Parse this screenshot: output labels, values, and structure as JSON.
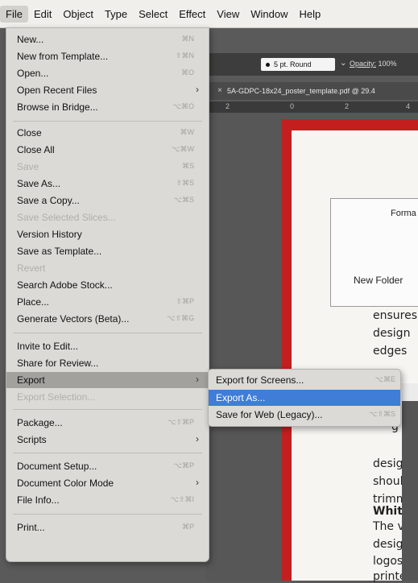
{
  "menubar": [
    "File",
    "Edit",
    "Object",
    "Type",
    "Select",
    "Effect",
    "View",
    "Window",
    "Help"
  ],
  "control_bar": {
    "stroke": "5 pt. Round",
    "opacity_label": "Opacity:",
    "opacity_value": "100%"
  },
  "document_tab": "5A-GDPC-18x24_poster_template.pdf @ 29.4",
  "ruler_ticks": [
    "2",
    "0",
    "2",
    "4"
  ],
  "dialog": {
    "format_label": "Forma",
    "new_folder": "New Folder"
  },
  "poster_text": [
    "ensures",
    "design",
    "edges",
    "g",
    "desig",
    "shoul",
    "trimm",
    "Whit",
    "The v",
    "desig",
    "logos",
    "printe"
  ],
  "file_menu": {
    "new": "New...",
    "new_k": "⌘N",
    "new_template": "New from Template...",
    "new_template_k": "⇧⌘N",
    "open": "Open...",
    "open_k": "⌘O",
    "open_recent": "Open Recent Files",
    "open_recent_arrow": "›",
    "bridge": "Browse in Bridge...",
    "bridge_k": "⌥⌘O",
    "close": "Close",
    "close_k": "⌘W",
    "close_all": "Close All",
    "close_all_k": "⌥⌘W",
    "save": "Save",
    "save_k": "⌘S",
    "save_as": "Save As...",
    "save_as_k": "⇧⌘S",
    "save_copy": "Save a Copy...",
    "save_copy_k": "⌥⌘S",
    "save_selected": "Save Selected Slices...",
    "version_history": "Version History",
    "save_template": "Save as Template...",
    "revert": "Revert",
    "search_stock": "Search Adobe Stock...",
    "place": "Place...",
    "place_k": "⇧⌘P",
    "gen_vectors": "Generate Vectors (Beta)...",
    "gen_vectors_k": "⌥⇧⌘G",
    "invite": "Invite to Edit...",
    "share_review": "Share for Review...",
    "export": "Export",
    "export_arrow": "›",
    "export_selection": "Export Selection...",
    "package": "Package...",
    "package_k": "⌥⇧⌘P",
    "scripts": "Scripts",
    "scripts_arrow": "›",
    "doc_setup": "Document Setup...",
    "doc_setup_k": "⌥⌘P",
    "doc_color": "Document Color Mode",
    "doc_color_arrow": "›",
    "file_info": "File Info...",
    "file_info_k": "⌥⇧⌘I",
    "print": "Print...",
    "print_k": "⌘P"
  },
  "export_submenu": {
    "screens": "Export for Screens...",
    "screens_k": "⌥⌘E",
    "export_as": "Export As...",
    "web_legacy": "Save for Web (Legacy)...",
    "web_legacy_k": "⌥⇧⌘S"
  }
}
